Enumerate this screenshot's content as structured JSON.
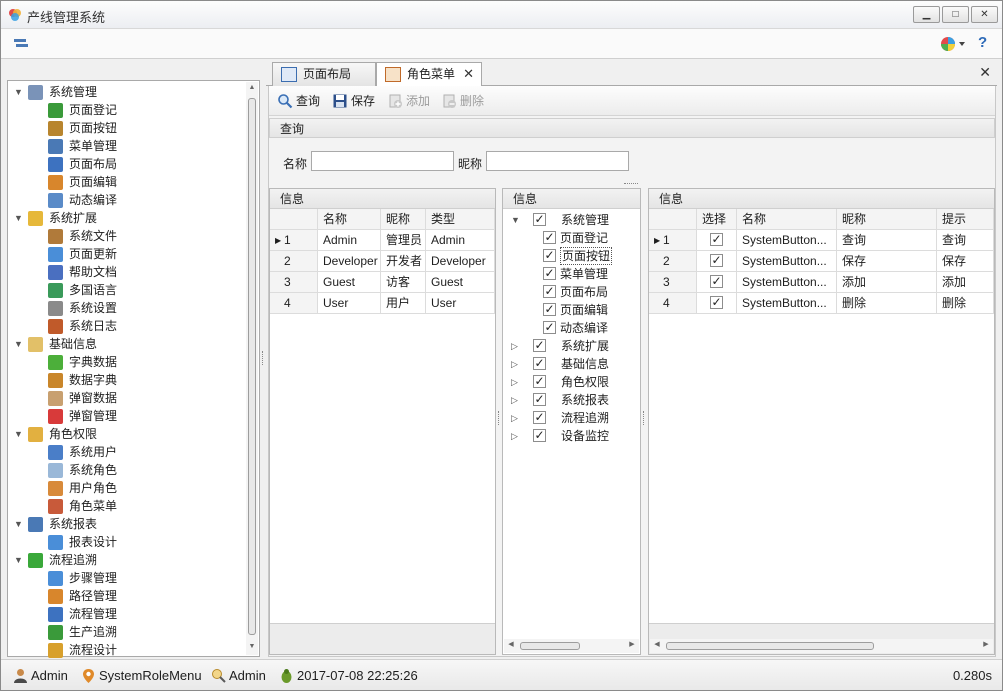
{
  "app": {
    "title": "产线管理系统"
  },
  "nav_tree": [
    {
      "label": "系统管理",
      "icon": "tools-icon",
      "color": "#7a93b8",
      "level": 0,
      "expanded": true
    },
    {
      "label": "页面登记",
      "icon": "page-add-icon",
      "color": "#3a9a3a",
      "level": 1
    },
    {
      "label": "页面按钮",
      "icon": "hammer-icon",
      "color": "#b8852e",
      "level": 1
    },
    {
      "label": "菜单管理",
      "icon": "menu-list-icon",
      "color": "#4a79b5",
      "level": 1
    },
    {
      "label": "页面布局",
      "icon": "layout-icon",
      "color": "#3d72c0",
      "level": 1
    },
    {
      "label": "页面编辑",
      "icon": "edit-page-icon",
      "color": "#d8862c",
      "level": 1
    },
    {
      "label": "动态编译",
      "icon": "compile-icon",
      "color": "#5a8bc8",
      "level": 1
    },
    {
      "label": "系统扩展",
      "icon": "puzzle-icon",
      "color": "#e6b83a",
      "level": 0,
      "expanded": true
    },
    {
      "label": "系统文件",
      "icon": "document-icon",
      "color": "#b07a3a",
      "level": 1
    },
    {
      "label": "页面更新",
      "icon": "up-arrow-icon",
      "color": "#4a8ed8",
      "level": 1
    },
    {
      "label": "帮助文档",
      "icon": "help-doc-icon",
      "color": "#4a6fc0",
      "level": 1
    },
    {
      "label": "多国语言",
      "icon": "globe-icon",
      "color": "#3a9a5a",
      "level": 1
    },
    {
      "label": "系统设置",
      "icon": "gear-icon",
      "color": "#8a8a8a",
      "level": 1
    },
    {
      "label": "系统日志",
      "icon": "log-icon",
      "color": "#c05a2a",
      "level": 1
    },
    {
      "label": "基础信息",
      "icon": "folder-icon",
      "color": "#e2c068",
      "level": 0,
      "expanded": true
    },
    {
      "label": "字典数据",
      "icon": "grass-icon",
      "color": "#4caf3a",
      "level": 1
    },
    {
      "label": "数据字典",
      "icon": "burger-icon",
      "color": "#c9862a",
      "level": 1
    },
    {
      "label": "弹窗数据",
      "icon": "dog-icon",
      "color": "#c8a070",
      "level": 1
    },
    {
      "label": "弹窗管理",
      "icon": "swirl-icon",
      "color": "#d83a3a",
      "level": 1
    },
    {
      "label": "角色权限",
      "icon": "key-icon",
      "color": "#e2b040",
      "level": 0,
      "expanded": true
    },
    {
      "label": "系统用户",
      "icon": "user-icon",
      "color": "#4a7ec8",
      "level": 1
    },
    {
      "label": "系统角色",
      "icon": "shield-icon",
      "color": "#9ab8d8",
      "level": 1
    },
    {
      "label": "用户角色",
      "icon": "users-icon",
      "color": "#d88a3a",
      "level": 1
    },
    {
      "label": "角色菜单",
      "icon": "role-menu-icon",
      "color": "#c85a3a",
      "level": 1
    },
    {
      "label": "系统报表",
      "icon": "report-icon",
      "color": "#4a79b5",
      "level": 0,
      "expanded": true
    },
    {
      "label": "报表设计",
      "icon": "report-design-icon",
      "color": "#4a8ed8",
      "level": 1
    },
    {
      "label": "流程追溯",
      "icon": "flow-icon",
      "color": "#3aa83a",
      "level": 0,
      "expanded": true
    },
    {
      "label": "步骤管理",
      "icon": "runner-icon",
      "color": "#4a8ed8",
      "level": 1
    },
    {
      "label": "路径管理",
      "icon": "signpost-icon",
      "color": "#d8862c",
      "level": 1
    },
    {
      "label": "流程管理",
      "icon": "hierarchy-icon",
      "color": "#3d72c0",
      "level": 1
    },
    {
      "label": "生产追溯",
      "icon": "trace-icon",
      "color": "#3a9a3a",
      "level": 1
    },
    {
      "label": "流程设计",
      "icon": "design-icon",
      "color": "#d8a02c",
      "level": 1
    }
  ],
  "tabs": [
    {
      "label": "页面布局",
      "active": false
    },
    {
      "label": "角色菜单",
      "active": true,
      "closable": true
    }
  ],
  "toolbar": {
    "query": "查询",
    "save": "保存",
    "add": "添加",
    "delete": "删除"
  },
  "query_panel": {
    "title": "查询",
    "name_label": "名称",
    "name_value": "",
    "nickname_label": "昵称",
    "nickname_value": ""
  },
  "roles_grid": {
    "title": "信息",
    "columns": [
      "",
      "名称",
      "昵称",
      "类型"
    ],
    "rows": [
      {
        "no": "1",
        "name": "Admin",
        "nickname": "管理员",
        "type": "Admin",
        "current": true
      },
      {
        "no": "2",
        "name": "Developer",
        "nickname": "开发者",
        "type": "Developer"
      },
      {
        "no": "3",
        "name": "Guest",
        "nickname": "访客",
        "type": "Guest"
      },
      {
        "no": "4",
        "name": "User",
        "nickname": "用户",
        "type": "User"
      }
    ]
  },
  "menu_tree": {
    "title": "信息",
    "items": [
      {
        "label": "系统管理",
        "level": 0,
        "expanded": true,
        "checked": true
      },
      {
        "label": "页面登记",
        "level": 1,
        "checked": true
      },
      {
        "label": "页面按钮",
        "level": 1,
        "checked": true,
        "focused": true
      },
      {
        "label": "菜单管理",
        "level": 1,
        "checked": true
      },
      {
        "label": "页面布局",
        "level": 1,
        "checked": true
      },
      {
        "label": "页面编辑",
        "level": 1,
        "checked": true
      },
      {
        "label": "动态编译",
        "level": 1,
        "checked": true
      },
      {
        "label": "系统扩展",
        "level": 0,
        "expanded": false,
        "checked": true
      },
      {
        "label": "基础信息",
        "level": 0,
        "expanded": false,
        "checked": true
      },
      {
        "label": "角色权限",
        "level": 0,
        "expanded": false,
        "checked": true
      },
      {
        "label": "系统报表",
        "level": 0,
        "expanded": false,
        "checked": true
      },
      {
        "label": "流程追溯",
        "level": 0,
        "expanded": false,
        "checked": true
      },
      {
        "label": "设备监控",
        "level": 0,
        "expanded": false,
        "checked": true
      }
    ]
  },
  "buttons_grid": {
    "title": "信息",
    "columns": [
      "",
      "选择",
      "名称",
      "昵称",
      "提示"
    ],
    "rows": [
      {
        "no": "1",
        "selected": true,
        "name": "SystemButton...",
        "nickname": "查询",
        "tip": "查询",
        "current": true
      },
      {
        "no": "2",
        "selected": true,
        "name": "SystemButton...",
        "nickname": "保存",
        "tip": "保存"
      },
      {
        "no": "3",
        "selected": true,
        "name": "SystemButton...",
        "nickname": "添加",
        "tip": "添加"
      },
      {
        "no": "4",
        "selected": true,
        "name": "SystemButton...",
        "nickname": "删除",
        "tip": "删除"
      }
    ]
  },
  "status": {
    "user": "Admin",
    "page": "SystemRoleMenu",
    "role": "Admin",
    "datetime": "2017-07-08 22:25:26",
    "elapsed": "0.280s"
  }
}
